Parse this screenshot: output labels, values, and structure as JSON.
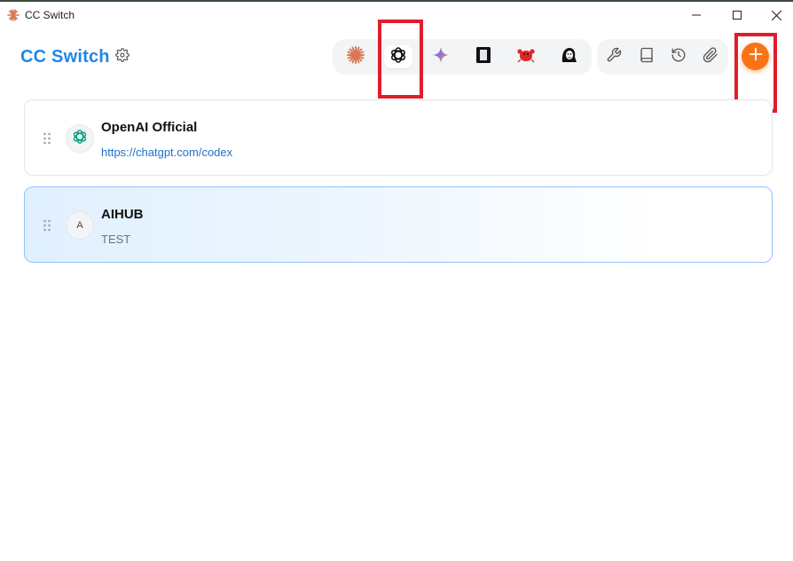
{
  "window": {
    "title": "CC Switch"
  },
  "header": {
    "brand": "CC Switch",
    "settings_icon": "gear-icon",
    "apps": [
      {
        "name": "Claude",
        "icon": "claude-asterisk-icon",
        "active": false
      },
      {
        "name": "Codex",
        "icon": "openai-knot-icon",
        "active": true
      },
      {
        "name": "Gemini",
        "icon": "gemini-sparkle-icon",
        "active": false
      },
      {
        "name": "Terminal",
        "icon": "terminal-box-icon",
        "active": false
      },
      {
        "name": "Crab",
        "icon": "red-crab-icon",
        "active": false
      },
      {
        "name": "Face",
        "icon": "face-avatar-icon",
        "active": false
      }
    ],
    "tools": [
      {
        "icon": "wrench-icon"
      },
      {
        "icon": "book-icon"
      },
      {
        "icon": "history-icon"
      },
      {
        "icon": "paperclip-icon"
      }
    ],
    "add_icon": "plus-icon"
  },
  "providers": [
    {
      "name": "OpenAI Official",
      "subtitle": "https://chatgpt.com/codex",
      "avatar": "openai-knot-icon",
      "selected": false
    },
    {
      "name": "AIHUB",
      "subtitle": "TEST",
      "avatar_letter": "A",
      "selected": true
    }
  ],
  "colors": {
    "brand": "#1e88e5",
    "accent_orange": "#f97316",
    "highlight_red": "#e11d2a",
    "selected_border": "#93c5fd"
  }
}
